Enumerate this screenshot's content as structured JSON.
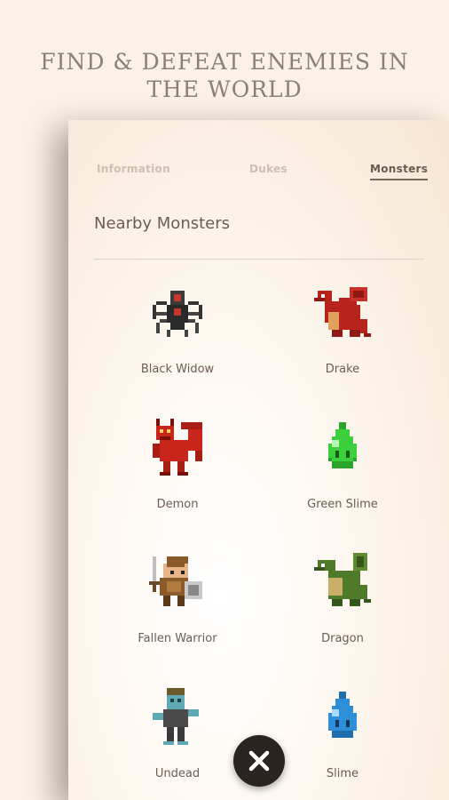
{
  "headline": "FIND & DEFEAT ENEMIES IN THE WORLD",
  "tabs": [
    {
      "label": "Information",
      "active": false
    },
    {
      "label": "Dukes",
      "active": false
    },
    {
      "label": "Monsters",
      "active": true
    }
  ],
  "section_title": "Nearby Monsters",
  "monsters": [
    {
      "name": "Black Widow",
      "icon": "black-widow-icon",
      "color": "#2a2a2a",
      "accent": "#c0392b"
    },
    {
      "name": "Drake",
      "icon": "drake-icon",
      "color": "#b8241c",
      "accent": "#e0a25a"
    },
    {
      "name": "Demon",
      "icon": "demon-icon",
      "color": "#c8261b",
      "accent": "#7a0f0a"
    },
    {
      "name": "Green Slime",
      "icon": "green-slime-icon",
      "color": "#3ccf3c",
      "accent": "#b6f7b6"
    },
    {
      "name": "Fallen Warrior",
      "icon": "fallen-warrior-icon",
      "color": "#8a5a2b",
      "accent": "#c9c9c9"
    },
    {
      "name": "Dragon",
      "icon": "dragon-icon",
      "color": "#4e7a2a",
      "accent": "#c9b069"
    },
    {
      "name": "Undead",
      "icon": "undead-icon",
      "color": "#5fa9b5",
      "accent": "#4a4a4a"
    },
    {
      "name": "Slime",
      "icon": "slime-icon",
      "color": "#2f8ed8",
      "accent": "#a8d8ff"
    }
  ],
  "close_icon": "close-icon"
}
